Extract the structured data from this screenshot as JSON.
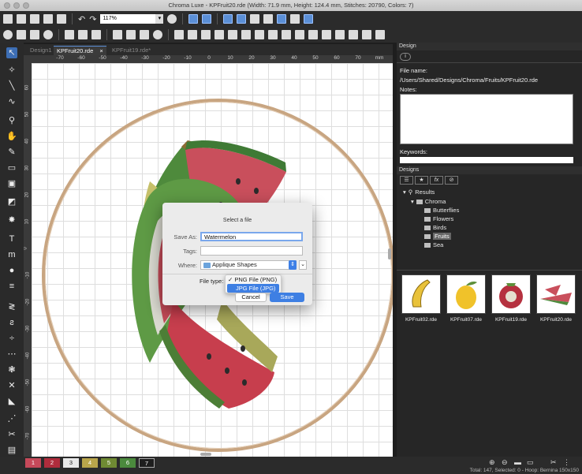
{
  "window": {
    "title": "Chroma Luxe - KPFruit20.rde (Width: 71.9 mm, Height: 124.4 mm, Stitches: 20790, Colors: 7)"
  },
  "toolbar": {
    "zoom_value": "117%"
  },
  "tabs": [
    {
      "label": "Design1"
    },
    {
      "label": "KPFruit20.rde",
      "close": "×"
    },
    {
      "label": "KPFruit19.rde*"
    }
  ],
  "ruler": {
    "h_ticks": [
      "-70",
      "-60",
      "-50",
      "-40",
      "-30",
      "-20",
      "-10",
      "0",
      "10",
      "20",
      "30",
      "40",
      "50",
      "60",
      "70",
      "mm"
    ],
    "v_ticks": [
      "60",
      "50",
      "40",
      "30",
      "20",
      "10",
      "0",
      "-10",
      "-20",
      "-30",
      "-40",
      "-50",
      "-60",
      "-70"
    ]
  },
  "dialog": {
    "title": "Select a file",
    "save_as_label": "Save As:",
    "save_as_value": "Watermelon",
    "tags_label": "Tags:",
    "tags_value": "",
    "where_label": "Where:",
    "where_value": "Applique Shapes",
    "file_type_label": "File type:",
    "file_type_options": [
      "✓ PNG File (PNG)",
      "JPG File (JPG)"
    ],
    "cancel_label": "Cancel",
    "save_label": "Save"
  },
  "design_panel": {
    "header": "Design",
    "file_name_label": "File name:",
    "file_path": "/Users/Shared/Designs/Chroma/Fruits/KPFruit20.rde",
    "notes_label": "Notes:",
    "keywords_label": "Keywords:"
  },
  "designs_panel": {
    "header": "Designs",
    "tree": {
      "root": "Results",
      "group": "Chroma",
      "folders": [
        "Butterflies",
        "Flowers",
        "Birds",
        "Fruits",
        "Sea"
      ],
      "selected": "Fruits"
    },
    "thumbnails": [
      "KPFruit02.rde",
      "KPFruit07.rde",
      "KPFruit19.rde",
      "KPFruit20.rde"
    ]
  },
  "color_swatches": [
    {
      "label": "1",
      "color": "#c6495a"
    },
    {
      "label": "2",
      "color": "#b02c3c"
    },
    {
      "label": "3",
      "color": "#e8e8e8"
    },
    {
      "label": "4",
      "color": "#b9a54b"
    },
    {
      "label": "5",
      "color": "#6f8a33"
    },
    {
      "label": "6",
      "color": "#4b8a3d"
    },
    {
      "label": "7",
      "color": "#1e1e1e"
    }
  ],
  "status": {
    "text": "Total: 147, Selected: 0 - Hoop: Bernina 150x150"
  }
}
